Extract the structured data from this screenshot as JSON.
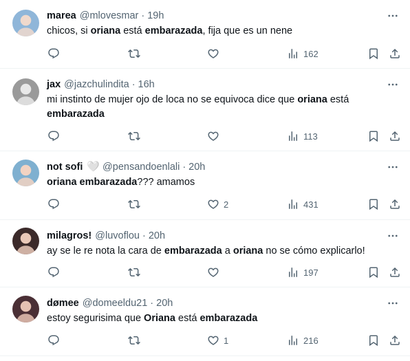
{
  "tweets": [
    {
      "name": "marea",
      "handle": "@mlovesmar",
      "time": "19h",
      "segments": [
        {
          "t": "chicos, si ",
          "b": false
        },
        {
          "t": "oriana",
          "b": true
        },
        {
          "t": " está ",
          "b": false
        },
        {
          "t": "embarazada",
          "b": true
        },
        {
          "t": ", fija que es un nene",
          "b": false
        }
      ],
      "replies": "",
      "retweets": "",
      "likes": "",
      "views": "162",
      "avatar_color": "#8fb6d9"
    },
    {
      "name": "jax",
      "handle": "@jazchulindita",
      "time": "16h",
      "segments": [
        {
          "t": "mi instinto de mujer ojo de loca no se equivoca dice que ",
          "b": false
        },
        {
          "t": "oriana",
          "b": true
        },
        {
          "t": " está ",
          "b": false
        },
        {
          "t": "embarazada",
          "b": true
        }
      ],
      "replies": "",
      "retweets": "",
      "likes": "",
      "views": "113",
      "avatar_color": "#9a9a9a"
    },
    {
      "name": "not sofi",
      "heart_emoji": "🤍",
      "handle": "@pensandoenlali",
      "time": "20h",
      "segments": [
        {
          "t": "oriana embarazada",
          "b": true
        },
        {
          "t": "??? amamos",
          "b": false
        }
      ],
      "replies": "",
      "retweets": "",
      "likes": "2",
      "views": "431",
      "avatar_color": "#7fb0d0"
    },
    {
      "name": "milagros!",
      "handle": "@luvoflou",
      "time": "20h",
      "segments": [
        {
          "t": "ay se le re nota la cara de ",
          "b": false
        },
        {
          "t": "embarazada",
          "b": true
        },
        {
          "t": " a ",
          "b": false
        },
        {
          "t": "oriana",
          "b": true
        },
        {
          "t": " no se cómo explicarlo!",
          "b": false
        }
      ],
      "replies": "",
      "retweets": "",
      "likes": "",
      "views": "197",
      "avatar_color": "#3b2a2a"
    },
    {
      "name": "dømee",
      "handle": "@domeeldu21",
      "time": "20h",
      "segments": [
        {
          "t": "estoy segurisima que ",
          "b": false
        },
        {
          "t": "Oriana",
          "b": true
        },
        {
          "t": " está ",
          "b": false
        },
        {
          "t": "embarazada",
          "b": true
        }
      ],
      "replies": "",
      "retweets": "",
      "likes": "1",
      "views": "216",
      "avatar_color": "#4a2f35"
    }
  ],
  "colors": {
    "text": "#0f1419",
    "muted": "#536471",
    "divider": "#eff3f4"
  },
  "icons": [
    "reply-icon",
    "retweet-icon",
    "like-icon",
    "views-icon",
    "bookmark-icon",
    "share-icon",
    "more-icon"
  ]
}
